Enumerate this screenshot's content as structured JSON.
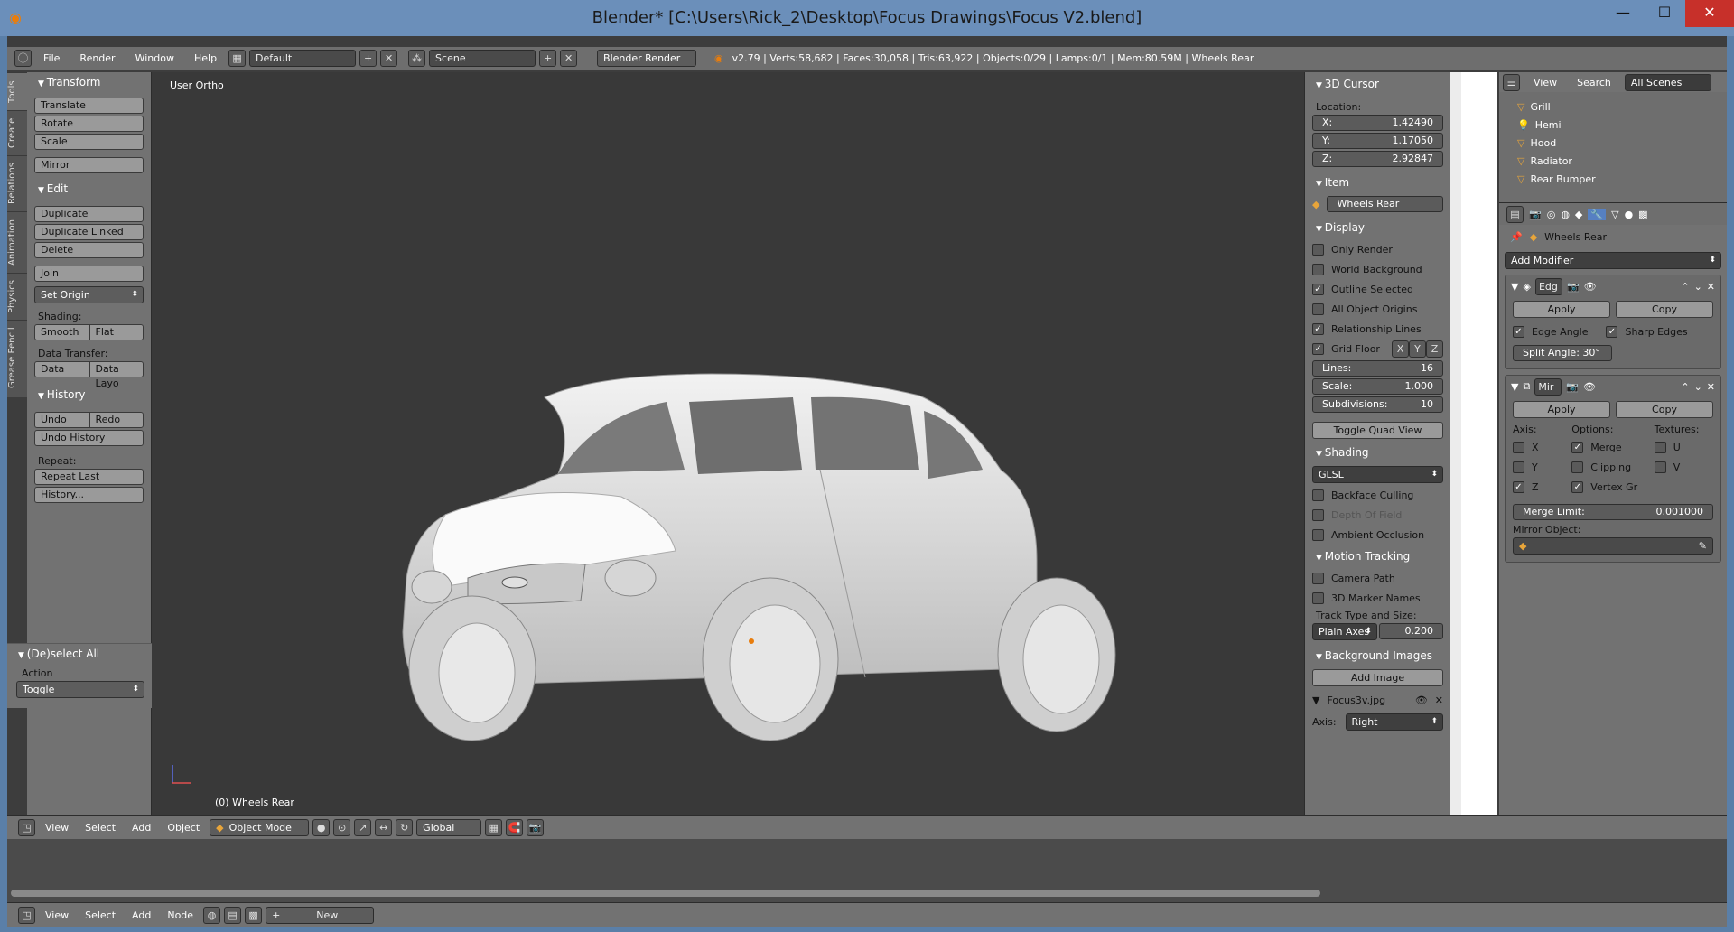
{
  "window": {
    "title": "Blender* [C:\\Users\\Rick_2\\Desktop\\Focus Drawings\\Focus V2.blend]"
  },
  "info_header": {
    "menus": [
      "File",
      "Render",
      "Window",
      "Help"
    ],
    "layout": "Default",
    "scene": "Scene",
    "engine": "Blender Render",
    "stats": "v2.79 | Verts:58,682 | Faces:30,058 | Tris:63,922 | Objects:0/29 | Lamps:0/1 | Mem:80.59M | Wheels Rear"
  },
  "tool_tabs": [
    "Tools",
    "Create",
    "Relations",
    "Animation",
    "Physics",
    "Grease Pencil"
  ],
  "tool_shelf": {
    "transform": {
      "title": "Transform",
      "buttons": [
        "Translate",
        "Rotate",
        "Scale",
        "Mirror"
      ]
    },
    "edit": {
      "title": "Edit",
      "buttons": [
        "Duplicate",
        "Duplicate Linked",
        "Delete",
        "Join"
      ],
      "set_origin": "Set Origin",
      "shading_label": "Shading:",
      "smooth": "Smooth",
      "flat": "Flat",
      "data_transfer_label": "Data Transfer:",
      "data": "Data",
      "data_layo": "Data Layo"
    },
    "history": {
      "title": "History",
      "undo": "Undo",
      "redo": "Redo",
      "undo_history": "Undo History",
      "repeat_label": "Repeat:",
      "repeat_last": "Repeat Last",
      "history": "History..."
    },
    "operator": {
      "title": "(De)select All",
      "action_label": "Action",
      "action_value": "Toggle"
    }
  },
  "viewport": {
    "label": "User Ortho",
    "active_object": "(0) Wheels Rear"
  },
  "npanel": {
    "cursor": {
      "title": "3D Cursor",
      "location_label": "Location:",
      "x_label": "X:",
      "x": "1.42490",
      "y_label": "Y:",
      "y": "1.17050",
      "z_label": "Z:",
      "z": "2.92847"
    },
    "item": {
      "title": "Item",
      "name": "Wheels Rear"
    },
    "display": {
      "title": "Display",
      "only_render": "Only Render",
      "world_background": "World Background",
      "outline_selected": "Outline Selected",
      "all_object_origins": "All Object Origins",
      "relationship_lines": "Relationship Lines",
      "grid_floor": "Grid Floor",
      "axis_x": "X",
      "axis_y": "Y",
      "axis_z": "Z",
      "lines_label": "Lines:",
      "lines": "16",
      "scale_label": "Scale:",
      "scale": "1.000",
      "subdiv_label": "Subdivisions:",
      "subdiv": "10",
      "toggle_quad": "Toggle Quad View"
    },
    "shading": {
      "title": "Shading",
      "mode": "GLSL",
      "backface": "Backface Culling",
      "dof": "Depth Of Field",
      "ao": "Ambient Occlusion"
    },
    "motion": {
      "title": "Motion Tracking",
      "camera_path": "Camera Path",
      "marker_names": "3D Marker Names",
      "track_label": "Track Type and Size:",
      "track_type": "Plain Axes",
      "track_size": "0.200"
    },
    "bg": {
      "title": "Background Images",
      "add_image": "Add Image",
      "image_name": "Focus3v.jpg",
      "axis_label": "Axis:",
      "axis_value": "Right"
    }
  },
  "outliner": {
    "view": "View",
    "search": "Search",
    "scenes": "All Scenes",
    "rows": [
      "Grill",
      "Hemi",
      "Hood",
      "Radiator",
      "Rear Bumper"
    ]
  },
  "properties": {
    "object_name": "Wheels Rear",
    "add_modifier": "Add Modifier",
    "edge_split": {
      "name": "Edg",
      "apply": "Apply",
      "copy": "Copy",
      "edge_angle": "Edge Angle",
      "sharp_edges": "Sharp Edges",
      "split_angle": "Split Angle: 30°"
    },
    "mirror": {
      "name": "Mir",
      "apply": "Apply",
      "copy": "Copy",
      "axis_label": "Axis:",
      "options_label": "Options:",
      "textures_label": "Textures:",
      "x": "X",
      "y": "Y",
      "z": "Z",
      "merge": "Merge",
      "clipping": "Clipping",
      "vertex_gr": "Vertex Gr",
      "u": "U",
      "v": "V",
      "merge_limit_label": "Merge Limit:",
      "merge_limit": "0.001000",
      "mirror_object_label": "Mirror Object:"
    }
  },
  "view3d_header": {
    "menus": [
      "View",
      "Select",
      "Add",
      "Object"
    ],
    "mode": "Object Mode",
    "orientation": "Global"
  },
  "node_header": {
    "menus": [
      "View",
      "Select",
      "Add",
      "Node"
    ],
    "new": "New"
  }
}
